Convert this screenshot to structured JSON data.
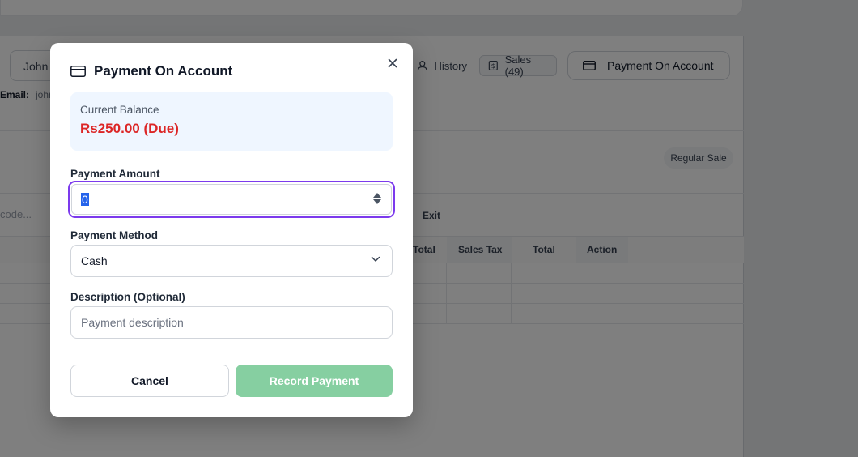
{
  "background": {
    "customer_button": "John",
    "email_label": "Email:",
    "email_value": "john",
    "history_label": "History",
    "sales_label": "Sales (49)",
    "payment_on_account_label": "Payment On Account",
    "regular_sale_label": "Regular Sale",
    "barcode_placeholder": "code...",
    "exit_label": "Exit",
    "table_headers": [
      "Total",
      "Sales Tax",
      "Total",
      "Action"
    ]
  },
  "modal": {
    "title": "Payment On Account",
    "close_icon": "close-icon",
    "balance": {
      "label": "Current Balance",
      "value": "Rs250.00 (Due)",
      "color": "#dc2626"
    },
    "amount": {
      "label": "Payment Amount",
      "value": "0"
    },
    "method": {
      "label": "Payment Method",
      "selected": "Cash"
    },
    "description": {
      "label": "Description (Optional)",
      "placeholder": "Payment description"
    },
    "cancel_label": "Cancel",
    "record_label": "Record Payment",
    "record_color": "#86cfa1",
    "focus_color": "#7c3aed"
  }
}
